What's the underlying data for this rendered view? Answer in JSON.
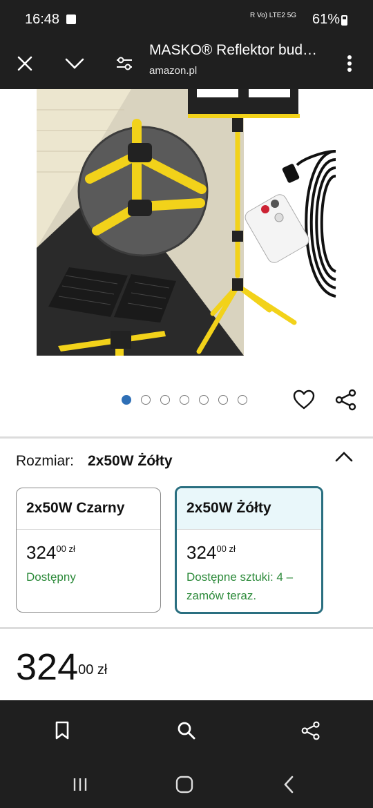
{
  "status_bar": {
    "time": "16:48",
    "battery": "61%",
    "signal_text": "R Vo) LTE2 5G"
  },
  "toolbar": {
    "title": "MASKO® Reflektor bud…",
    "domain": "amazon.pl",
    "icons": [
      "close-icon",
      "chevron-down-icon",
      "tune-icon",
      "more-vert-icon"
    ]
  },
  "gallery": {
    "dot_count": 7,
    "active_dot": 0,
    "product_image": "tripod-work-lamp-photo"
  },
  "size_selector": {
    "label": "Rozmiar:",
    "selected": "2x50W Żółty",
    "options": [
      {
        "name": "2x50W Czarny",
        "price_main": "324",
        "price_cents": "00 zł",
        "availability": "Dostępny"
      },
      {
        "name": "2x50W Żółty",
        "price_main": "324",
        "price_cents": "00 zł",
        "availability": "Dostępne sztuki: 4 – zamów teraz."
      }
    ]
  },
  "price": {
    "main": "324",
    "cents": "00 zł"
  },
  "bottom_bar": {
    "icons": [
      "bookmark-icon",
      "search-icon",
      "share-icon"
    ]
  },
  "nav_bar": {
    "icons": [
      "recents-icon",
      "home-icon",
      "back-icon"
    ]
  },
  "colors": {
    "bar_bg": "#1f1f1f",
    "accent_dot": "#2e6fb6",
    "selected_border": "#2a6f80",
    "available_green": "#2c8a3a"
  }
}
